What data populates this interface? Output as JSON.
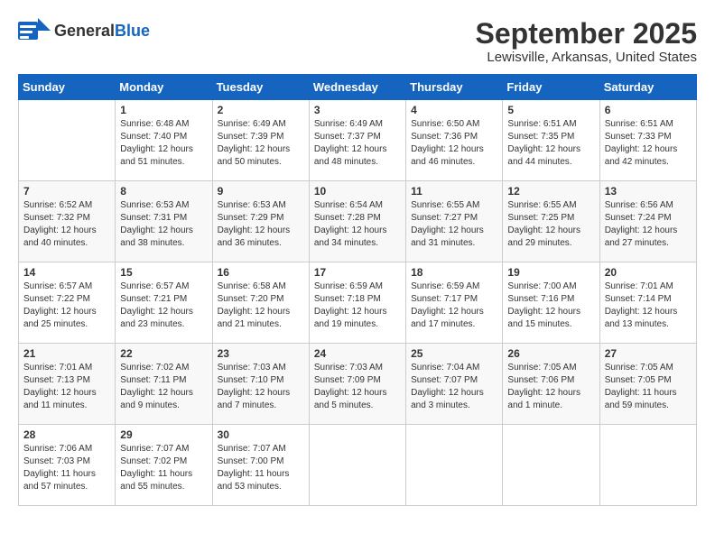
{
  "header": {
    "logo_general": "General",
    "logo_blue": "Blue",
    "title": "September 2025",
    "subtitle": "Lewisville, Arkansas, United States"
  },
  "calendar": {
    "days": [
      "Sunday",
      "Monday",
      "Tuesday",
      "Wednesday",
      "Thursday",
      "Friday",
      "Saturday"
    ],
    "weeks": [
      [
        {
          "date": "",
          "info": ""
        },
        {
          "date": "1",
          "info": "Sunrise: 6:48 AM\nSunset: 7:40 PM\nDaylight: 12 hours\nand 51 minutes."
        },
        {
          "date": "2",
          "info": "Sunrise: 6:49 AM\nSunset: 7:39 PM\nDaylight: 12 hours\nand 50 minutes."
        },
        {
          "date": "3",
          "info": "Sunrise: 6:49 AM\nSunset: 7:37 PM\nDaylight: 12 hours\nand 48 minutes."
        },
        {
          "date": "4",
          "info": "Sunrise: 6:50 AM\nSunset: 7:36 PM\nDaylight: 12 hours\nand 46 minutes."
        },
        {
          "date": "5",
          "info": "Sunrise: 6:51 AM\nSunset: 7:35 PM\nDaylight: 12 hours\nand 44 minutes."
        },
        {
          "date": "6",
          "info": "Sunrise: 6:51 AM\nSunset: 7:33 PM\nDaylight: 12 hours\nand 42 minutes."
        }
      ],
      [
        {
          "date": "7",
          "info": "Sunrise: 6:52 AM\nSunset: 7:32 PM\nDaylight: 12 hours\nand 40 minutes."
        },
        {
          "date": "8",
          "info": "Sunrise: 6:53 AM\nSunset: 7:31 PM\nDaylight: 12 hours\nand 38 minutes."
        },
        {
          "date": "9",
          "info": "Sunrise: 6:53 AM\nSunset: 7:29 PM\nDaylight: 12 hours\nand 36 minutes."
        },
        {
          "date": "10",
          "info": "Sunrise: 6:54 AM\nSunset: 7:28 PM\nDaylight: 12 hours\nand 34 minutes."
        },
        {
          "date": "11",
          "info": "Sunrise: 6:55 AM\nSunset: 7:27 PM\nDaylight: 12 hours\nand 31 minutes."
        },
        {
          "date": "12",
          "info": "Sunrise: 6:55 AM\nSunset: 7:25 PM\nDaylight: 12 hours\nand 29 minutes."
        },
        {
          "date": "13",
          "info": "Sunrise: 6:56 AM\nSunset: 7:24 PM\nDaylight: 12 hours\nand 27 minutes."
        }
      ],
      [
        {
          "date": "14",
          "info": "Sunrise: 6:57 AM\nSunset: 7:22 PM\nDaylight: 12 hours\nand 25 minutes."
        },
        {
          "date": "15",
          "info": "Sunrise: 6:57 AM\nSunset: 7:21 PM\nDaylight: 12 hours\nand 23 minutes."
        },
        {
          "date": "16",
          "info": "Sunrise: 6:58 AM\nSunset: 7:20 PM\nDaylight: 12 hours\nand 21 minutes."
        },
        {
          "date": "17",
          "info": "Sunrise: 6:59 AM\nSunset: 7:18 PM\nDaylight: 12 hours\nand 19 minutes."
        },
        {
          "date": "18",
          "info": "Sunrise: 6:59 AM\nSunset: 7:17 PM\nDaylight: 12 hours\nand 17 minutes."
        },
        {
          "date": "19",
          "info": "Sunrise: 7:00 AM\nSunset: 7:16 PM\nDaylight: 12 hours\nand 15 minutes."
        },
        {
          "date": "20",
          "info": "Sunrise: 7:01 AM\nSunset: 7:14 PM\nDaylight: 12 hours\nand 13 minutes."
        }
      ],
      [
        {
          "date": "21",
          "info": "Sunrise: 7:01 AM\nSunset: 7:13 PM\nDaylight: 12 hours\nand 11 minutes."
        },
        {
          "date": "22",
          "info": "Sunrise: 7:02 AM\nSunset: 7:11 PM\nDaylight: 12 hours\nand 9 minutes."
        },
        {
          "date": "23",
          "info": "Sunrise: 7:03 AM\nSunset: 7:10 PM\nDaylight: 12 hours\nand 7 minutes."
        },
        {
          "date": "24",
          "info": "Sunrise: 7:03 AM\nSunset: 7:09 PM\nDaylight: 12 hours\nand 5 minutes."
        },
        {
          "date": "25",
          "info": "Sunrise: 7:04 AM\nSunset: 7:07 PM\nDaylight: 12 hours\nand 3 minutes."
        },
        {
          "date": "26",
          "info": "Sunrise: 7:05 AM\nSunset: 7:06 PM\nDaylight: 12 hours\nand 1 minute."
        },
        {
          "date": "27",
          "info": "Sunrise: 7:05 AM\nSunset: 7:05 PM\nDaylight: 11 hours\nand 59 minutes."
        }
      ],
      [
        {
          "date": "28",
          "info": "Sunrise: 7:06 AM\nSunset: 7:03 PM\nDaylight: 11 hours\nand 57 minutes."
        },
        {
          "date": "29",
          "info": "Sunrise: 7:07 AM\nSunset: 7:02 PM\nDaylight: 11 hours\nand 55 minutes."
        },
        {
          "date": "30",
          "info": "Sunrise: 7:07 AM\nSunset: 7:00 PM\nDaylight: 11 hours\nand 53 minutes."
        },
        {
          "date": "",
          "info": ""
        },
        {
          "date": "",
          "info": ""
        },
        {
          "date": "",
          "info": ""
        },
        {
          "date": "",
          "info": ""
        }
      ]
    ]
  }
}
